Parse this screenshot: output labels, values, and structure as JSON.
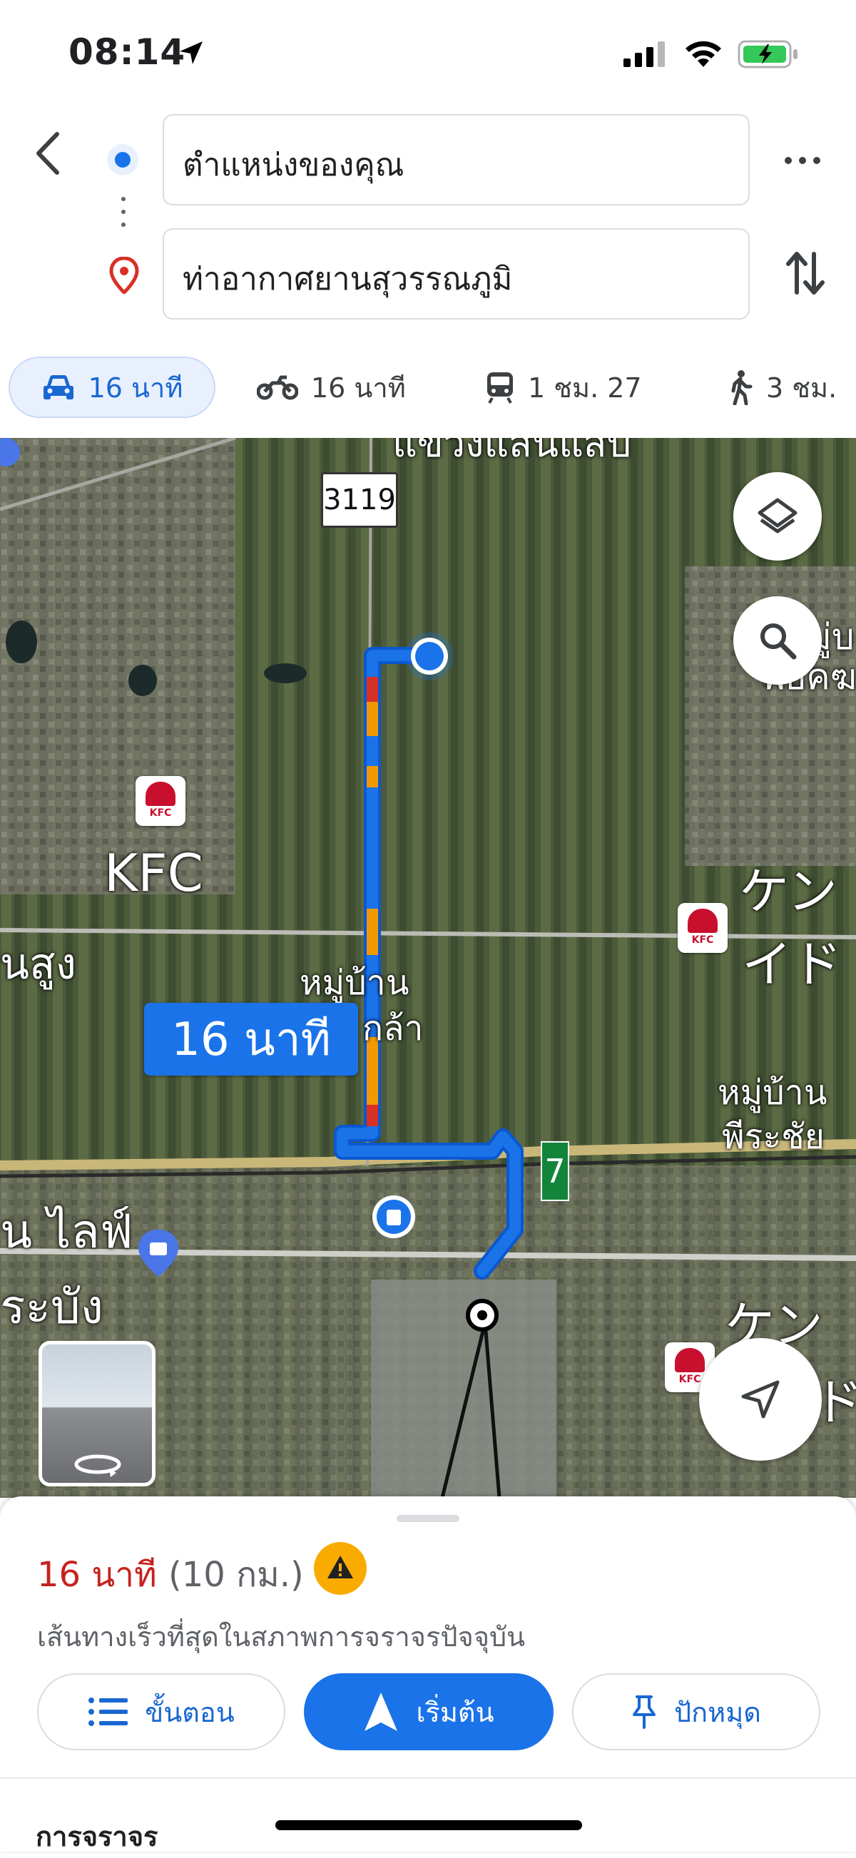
{
  "status_bar": {
    "time": "08:14",
    "icons": [
      "location-arrow-icon",
      "cellular-signal-icon",
      "wifi-icon",
      "battery-charging-icon"
    ],
    "battery_color": "#34c759"
  },
  "header": {
    "back_icon": "chevron-left-icon",
    "origin": "ตำแหน่งของคุณ",
    "destination": "ท่าอากาศยานสุวรรณภูมิ",
    "more_icon": "more-horizontal-icon",
    "swap_icon": "swap-vertical-icon"
  },
  "modes": [
    {
      "icon": "car-icon",
      "label": "16 นาที",
      "active": true
    },
    {
      "icon": "motorcycle-icon",
      "label": "16 นาที",
      "active": false
    },
    {
      "icon": "train-icon",
      "label": "1 ชม. 27",
      "active": false
    },
    {
      "icon": "walking-icon",
      "label": "3 ชม.",
      "active": false
    }
  ],
  "map": {
    "route_duration_label": "16 นาที",
    "road_number": "3119",
    "labels": {
      "top_cut": "แขวงแสนแสบ",
      "kfc": "KFC",
      "village1": "หมู่บ้าน",
      "village1b": "กล้า",
      "village2": "หมู่บ้าน",
      "village2b": "พีระชัย",
      "left_suung": "นสูง",
      "left_life": "น ไลฟ์",
      "left_rabang": "ระบัง",
      "right_top1": "หมู่บ",
      "right_top2": "พยัคฆ",
      "right_ken1": "ケン",
      "right_id": "イド",
      "right_ken2": "ケン",
      "right_d": "ド",
      "seven_eleven": "7",
      "kfc_badge": "KFC"
    },
    "layers_icon": "layers-icon",
    "search_icon": "search-icon",
    "recenter_icon": "navigation-arrow-icon",
    "streetview_icon": "rotate-360-icon",
    "route_color": "#1a73e8",
    "traffic_colors": {
      "slow": "#f29900",
      "heavy": "#d93025"
    }
  },
  "sheet": {
    "eta": "16 นาที",
    "distance": "(10 กม.)",
    "warning_icon": "warning-icon",
    "subtitle": "เส้นทางเร็วที่สุดในสภาพการจราจรปัจจุบัน",
    "buttons": {
      "steps": "ขั้นตอน",
      "start": "เริ่มต้น",
      "pin": "ปักหมุด"
    },
    "section_title": "การจราจร"
  }
}
